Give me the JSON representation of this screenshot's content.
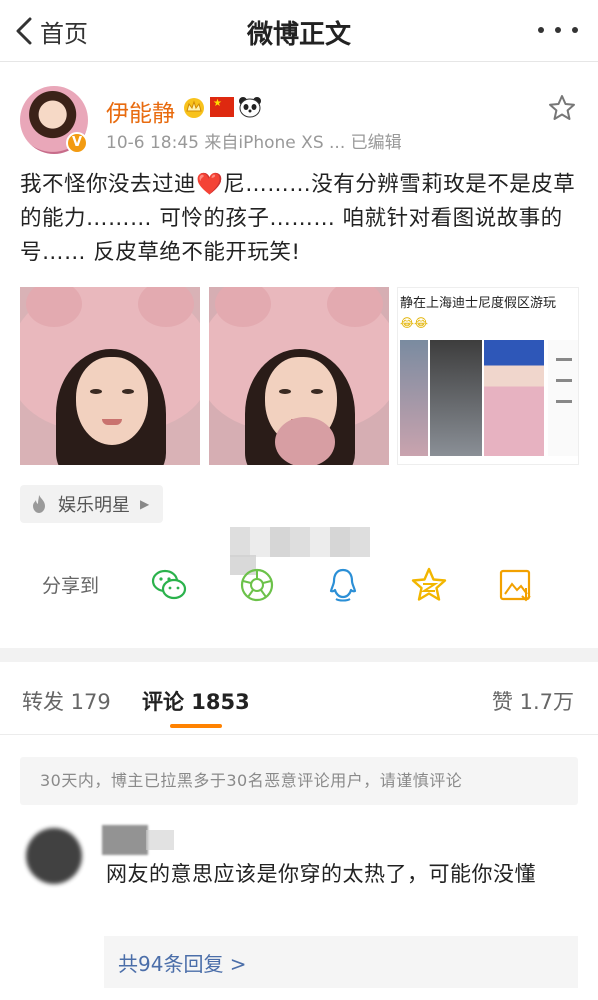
{
  "nav": {
    "back_label": "首页",
    "title": "微博正文"
  },
  "post": {
    "username": "伊能静",
    "avatar_badge": "V",
    "meta": "10-6 18:45  来自iPhone XS ...  已编辑",
    "text_before_heart": "我不怪你没去过迪",
    "heart": "❤️",
    "text_after_heart": "尼………没有分辨雪莉玫是不是皮草的能力……… 可怜的孩子……… 咱就针对看图说故事的号…… 反皮草绝不能开玩笑!",
    "image3_caption": "静在上海迪士尼度假区游玩",
    "image3_emoji": "😂😂"
  },
  "topic": {
    "label": "娱乐明星"
  },
  "share": {
    "label": "分享到"
  },
  "tabs": {
    "repost": "转发 179",
    "comment": "评论 1853",
    "like": "赞 1.7万"
  },
  "notice": "30天内，博主已拉黑多于30名恶意评论用户，请谨慎评论",
  "comment": {
    "text": "网友的意思应该是你穿的太热了，可能你没懂",
    "replies": "共94条回复 >"
  },
  "colors": {
    "accent": "#ff8200",
    "username": "#e86b0f",
    "link": "#4b6ea9"
  }
}
